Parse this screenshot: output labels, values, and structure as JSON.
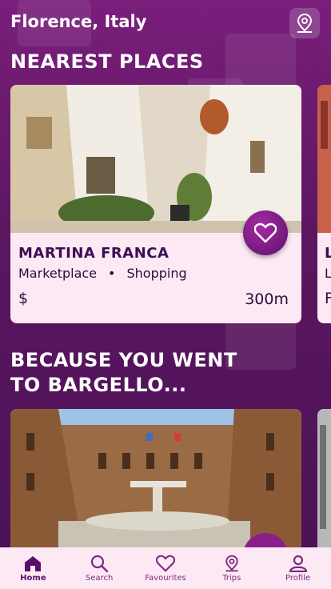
{
  "header": {
    "city": "Florence, Italy",
    "location_icon": "map-pin-icon"
  },
  "sections": {
    "nearest": "NEAREST PLACES",
    "because": "BECAUSE YOU WENT TO BARGELLO..."
  },
  "nearest_cards": [
    {
      "name": "MARTINA FRANCA",
      "tag1": "Marketplace",
      "tag2": "Shopping",
      "price": "$",
      "distance": "300m"
    },
    {
      "name": "L",
      "tag1": "L",
      "price": "F"
    }
  ],
  "nav": [
    {
      "label": "Home",
      "icon": "home-icon",
      "active": true
    },
    {
      "label": "Search",
      "icon": "search-icon"
    },
    {
      "label": "Favourites",
      "icon": "heart-icon"
    },
    {
      "label": "Trips",
      "icon": "map-pin-icon"
    },
    {
      "label": "Profile",
      "icon": "user-icon"
    }
  ],
  "colors": {
    "accent": "#7a1f7c",
    "card_bg": "#fde9f3",
    "fav_btn": "#8a1f8c"
  }
}
